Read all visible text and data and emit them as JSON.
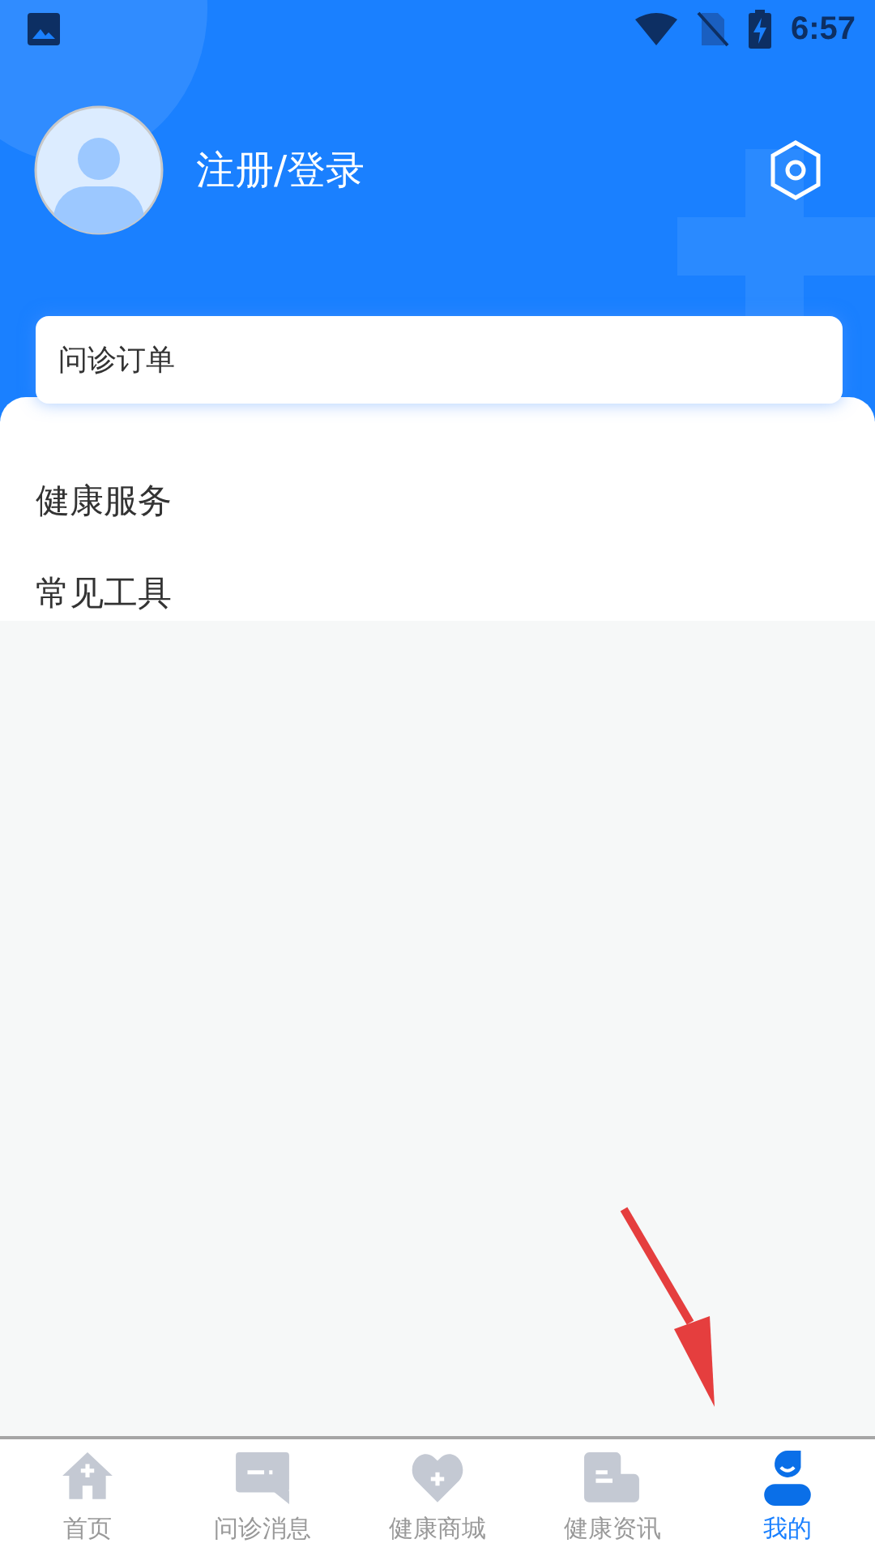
{
  "status_bar": {
    "time": "6:57"
  },
  "profile": {
    "login_label": "注册/登录"
  },
  "order_card": {
    "title": "问诊订单"
  },
  "sections": [
    {
      "title": "健康服务"
    },
    {
      "title": "常见工具"
    }
  ],
  "tab_bar": [
    {
      "label": "首页",
      "kind": "home",
      "selected": false
    },
    {
      "label": "问诊消息",
      "kind": "chat",
      "selected": false
    },
    {
      "label": "健康商城",
      "kind": "heart",
      "selected": false
    },
    {
      "label": "健康资讯",
      "kind": "news",
      "selected": false
    },
    {
      "label": "我的",
      "kind": "person",
      "selected": true
    }
  ]
}
